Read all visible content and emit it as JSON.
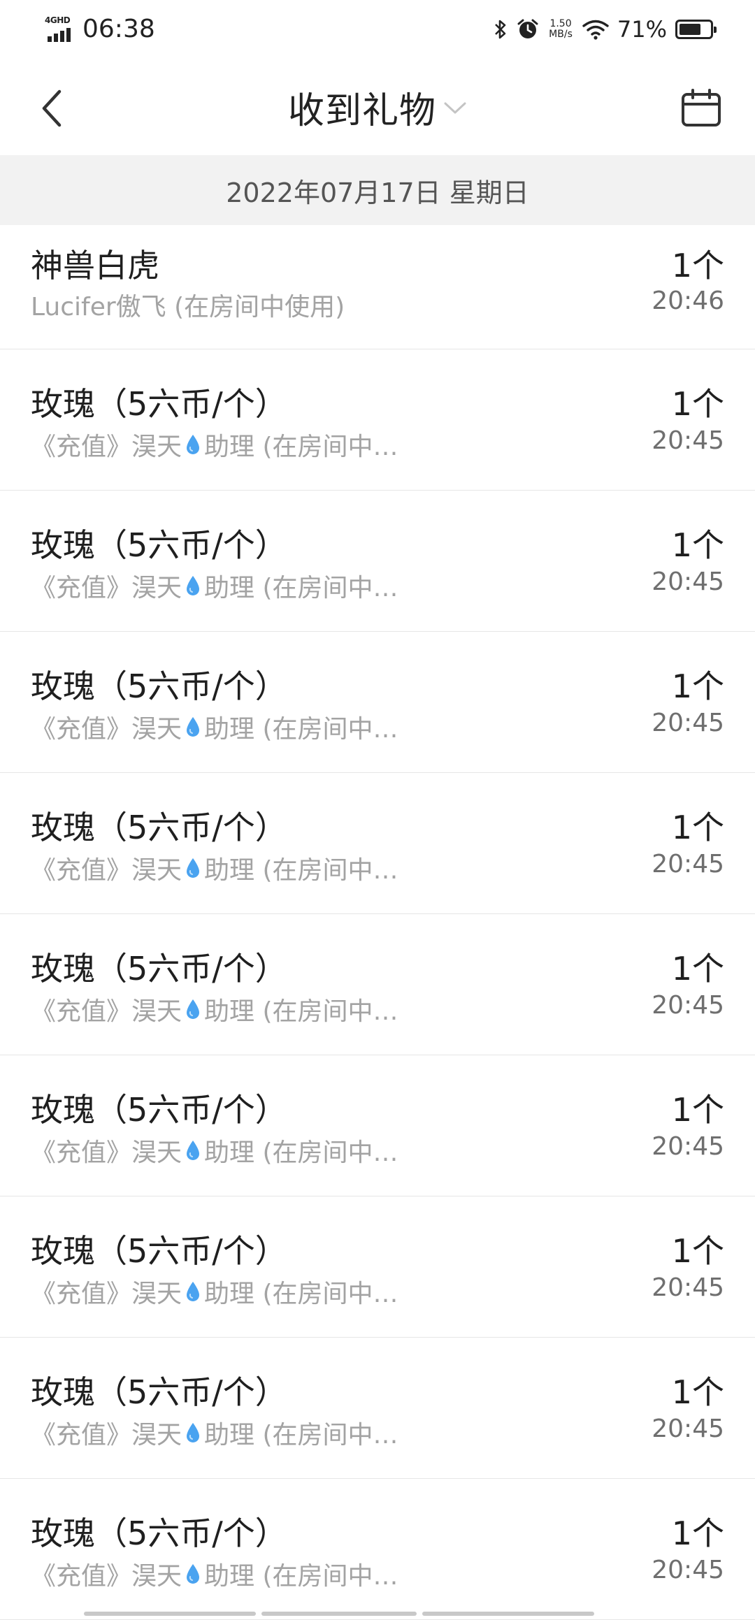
{
  "status_bar": {
    "network": "4GHD",
    "time": "06:38",
    "net_speed_value": "1.50",
    "net_speed_unit": "MB/s",
    "battery_percent": "71%",
    "battery_level": 0.71,
    "icons": [
      "bluetooth-icon",
      "alarm-icon",
      "wifi-icon",
      "battery-icon"
    ]
  },
  "nav": {
    "title": "收到礼物",
    "back_icon": "chevron-left-icon",
    "title_dropdown_icon": "chevron-down-icon",
    "calendar_icon": "calendar-icon"
  },
  "date_header": "2022年07月17日 星期日",
  "gifts": [
    {
      "name": "神兽白虎",
      "sender_pre": "Lucifer傲飞 (在房间中使用)",
      "sender_drop": false,
      "sender_post": "",
      "count": "1个",
      "time": "20:46"
    },
    {
      "name": "玫瑰（5六币/个）",
      "sender_pre": "《充值》淏天",
      "sender_drop": true,
      "sender_post": "助理 (在房间中…",
      "count": "1个",
      "time": "20:45"
    },
    {
      "name": "玫瑰（5六币/个）",
      "sender_pre": "《充值》淏天",
      "sender_drop": true,
      "sender_post": "助理 (在房间中…",
      "count": "1个",
      "time": "20:45"
    },
    {
      "name": "玫瑰（5六币/个）",
      "sender_pre": "《充值》淏天",
      "sender_drop": true,
      "sender_post": "助理 (在房间中…",
      "count": "1个",
      "time": "20:45"
    },
    {
      "name": "玫瑰（5六币/个）",
      "sender_pre": "《充值》淏天",
      "sender_drop": true,
      "sender_post": "助理 (在房间中…",
      "count": "1个",
      "time": "20:45"
    },
    {
      "name": "玫瑰（5六币/个）",
      "sender_pre": "《充值》淏天",
      "sender_drop": true,
      "sender_post": "助理 (在房间中…",
      "count": "1个",
      "time": "20:45"
    },
    {
      "name": "玫瑰（5六币/个）",
      "sender_pre": "《充值》淏天",
      "sender_drop": true,
      "sender_post": "助理 (在房间中…",
      "count": "1个",
      "time": "20:45"
    },
    {
      "name": "玫瑰（5六币/个）",
      "sender_pre": "《充值》淏天",
      "sender_drop": true,
      "sender_post": "助理 (在房间中…",
      "count": "1个",
      "time": "20:45"
    },
    {
      "name": "玫瑰（5六币/个）",
      "sender_pre": "《充值》淏天",
      "sender_drop": true,
      "sender_post": "助理 (在房间中…",
      "count": "1个",
      "time": "20:45"
    },
    {
      "name": "玫瑰（5六币/个）",
      "sender_pre": "《充值》淏天",
      "sender_drop": true,
      "sender_post": "助理 (在房间中…",
      "count": "1个",
      "time": "20:45"
    }
  ],
  "colors": {
    "text_primary": "#1f1f1f",
    "text_secondary": "#a3a3a3",
    "date_header_bg": "#f2f2f2",
    "drop_icon": "#4aa3f0"
  }
}
